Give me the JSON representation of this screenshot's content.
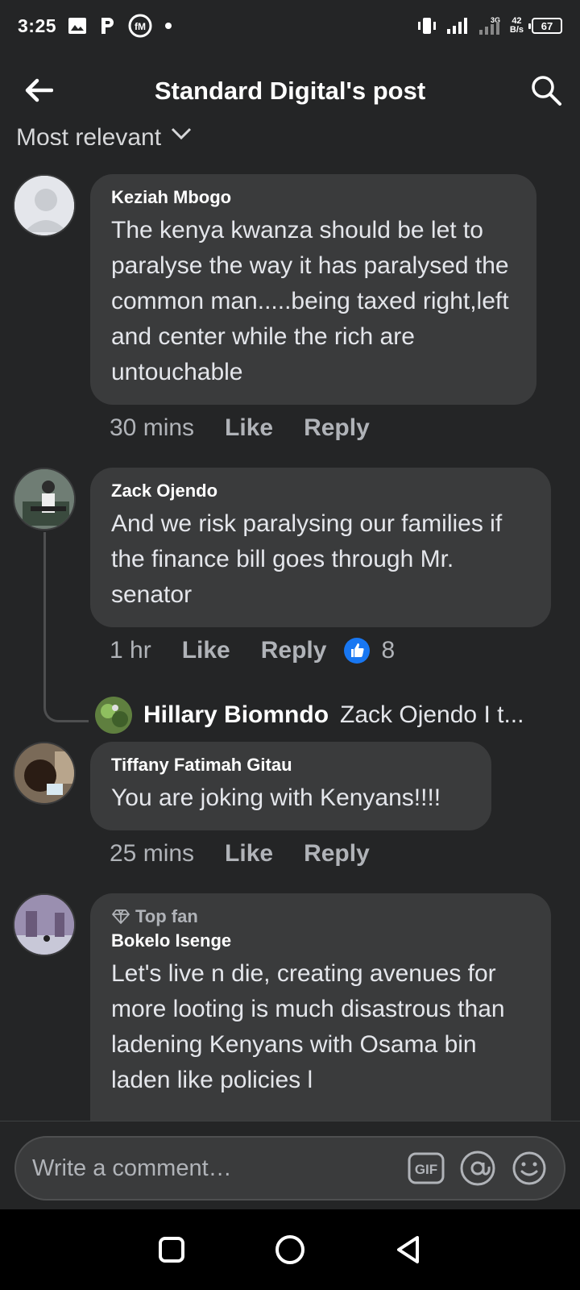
{
  "status_bar": {
    "time": "3:25",
    "net_speed_value": "42",
    "net_speed_unit": "B/s",
    "network_type": "3G",
    "battery": "67"
  },
  "header": {
    "title": "Standard Digital's post"
  },
  "sort": {
    "label": "Most relevant"
  },
  "comments": [
    {
      "author": "Keziah Mbogo",
      "text": "The kenya kwanza should be let to paralyse the way it has paralysed the common man.....being taxed right,left and center while the rich are untouchable",
      "time": "30 mins",
      "like": "Like",
      "reply": "Reply"
    },
    {
      "author": "Zack Ojendo",
      "text": "And  we risk paralysing our families if the finance bill goes through Mr. senator",
      "time": "1 hr",
      "like": "Like",
      "reply": "Reply",
      "reaction_count": "8",
      "reply_preview": {
        "author": "Hillary Biomndo",
        "snippet": "Zack Ojendo I t..."
      }
    },
    {
      "author": "Tiffany Fatimah Gitau",
      "text": "You are joking with Kenyans!!!!",
      "time": "25 mins",
      "like": "Like",
      "reply": "Reply"
    },
    {
      "badge": "Top fan",
      "author": "Bokelo Isenge",
      "text": "Let's live n die, creating avenues for more looting is  much disastrous than ladening Kenyans with Osama bin laden  like policies l"
    }
  ],
  "composer": {
    "placeholder": "Write a comment…",
    "gif_label": "GIF"
  },
  "colors": {
    "background": "#242526",
    "bubble": "#3a3b3c",
    "like_blue": "#1877f2",
    "secondary_text": "#b0b3b8"
  }
}
